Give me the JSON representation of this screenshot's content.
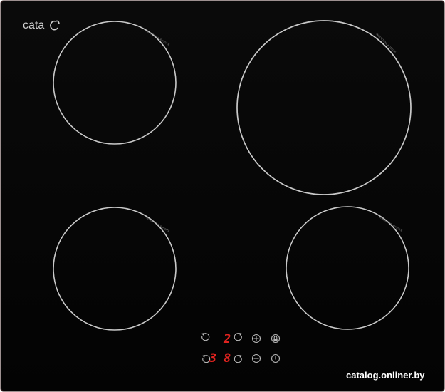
{
  "brand": {
    "name": "cata"
  },
  "colors": {
    "glass": "#050505",
    "frame": "#4a2a2a",
    "zone_ring": "#c9c9c9",
    "display_red": "#e0231f",
    "symbol_grey": "#b9b9b9"
  },
  "zones": [
    {
      "id": "top-left",
      "label": "INDUCTION AUSSITE"
    },
    {
      "id": "top-right",
      "label": "INDUCTION AUSSITE"
    },
    {
      "id": "bottom-left",
      "label": "INDUCTION AUSSITE"
    },
    {
      "id": "bottom-right",
      "label": "INDUCTION AUSSITE"
    }
  ],
  "control_panel": {
    "top_display": "2",
    "bottom_display_left": "3",
    "bottom_display_right": "8",
    "icons": [
      "zone-select-left-icon",
      "zone-select-right-icon",
      "plus-icon",
      "lock-icon",
      "minus-icon",
      "power-icon"
    ]
  },
  "watermark": {
    "text": "catalog.onliner.by"
  }
}
